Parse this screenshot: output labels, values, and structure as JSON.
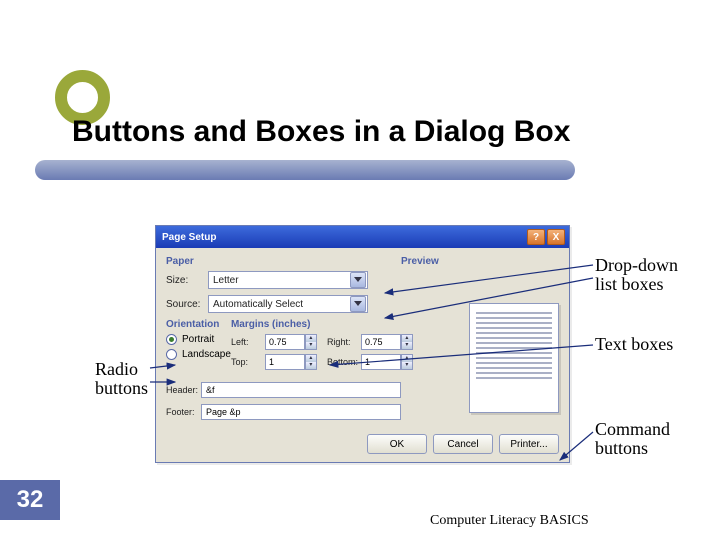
{
  "slide": {
    "title": "Buttons and Boxes in a Dialog Box",
    "page_number": "32",
    "footer": "Computer Literacy BASICS"
  },
  "callouts": {
    "dropdown": "Drop-down list boxes",
    "textboxes": "Text boxes",
    "radio": "Radio buttons",
    "command": "Command buttons"
  },
  "dialog": {
    "title": "Page Setup",
    "help_glyph": "?",
    "close_glyph": "X",
    "sections": {
      "paper": "Paper",
      "orientation": "Orientation",
      "margins": "Margins (inches)",
      "preview": "Preview"
    },
    "paper": {
      "size_label": "Size:",
      "size_value": "Letter",
      "source_label": "Source:",
      "source_value": "Automatically Select"
    },
    "orientation": {
      "portrait_label": "Portrait",
      "landscape_label": "Landscape",
      "selected": "portrait"
    },
    "margins": {
      "left_label": "Left:",
      "left_value": "0.75",
      "right_label": "Right:",
      "right_value": "0.75",
      "top_label": "Top:",
      "top_value": "1",
      "bottom_label": "Bottom:",
      "bottom_value": "1"
    },
    "hf": {
      "header_label": "Header:",
      "header_value": "&f",
      "footer_label": "Footer:",
      "footer_value": "Page &p"
    },
    "buttons": {
      "ok": "OK",
      "cancel": "Cancel",
      "printer": "Printer..."
    }
  }
}
